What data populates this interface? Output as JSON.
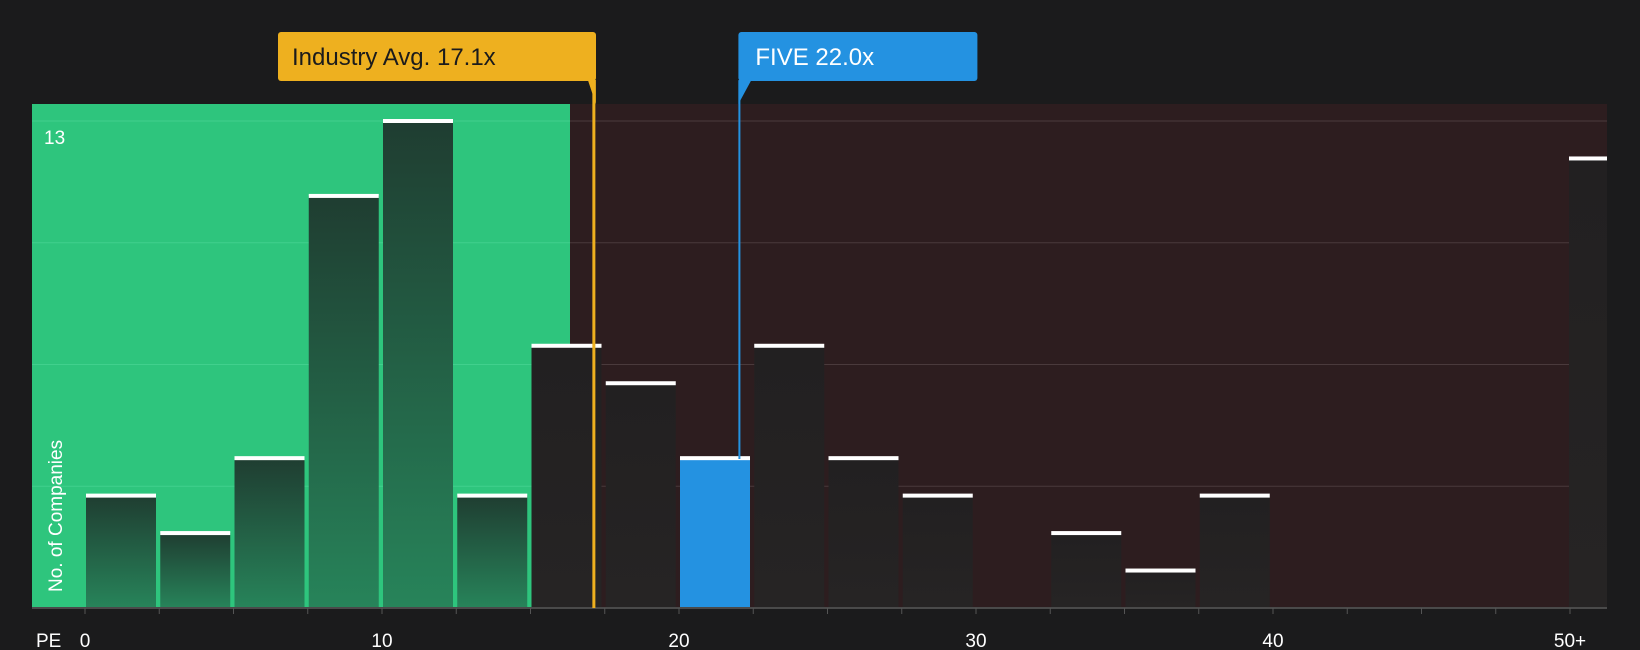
{
  "chart_data": {
    "type": "bar",
    "xlabel": "PE",
    "ylabel": "No. of Companies",
    "ymax_label": "13",
    "ylim": [
      0,
      13
    ],
    "bin_width": 2.5,
    "x_ticks": [
      "0",
      "10",
      "20",
      "30",
      "40",
      "50+"
    ],
    "bins": [
      {
        "x_start": 0,
        "count": 3
      },
      {
        "x_start": 2.5,
        "count": 2
      },
      {
        "x_start": 5,
        "count": 4
      },
      {
        "x_start": 7.5,
        "count": 11
      },
      {
        "x_start": 10,
        "count": 13
      },
      {
        "x_start": 12.5,
        "count": 3
      },
      {
        "x_start": 15,
        "count": 7
      },
      {
        "x_start": 17.5,
        "count": 6
      },
      {
        "x_start": 20,
        "count": 4,
        "highlight": true
      },
      {
        "x_start": 22.5,
        "count": 7
      },
      {
        "x_start": 25,
        "count": 4
      },
      {
        "x_start": 27.5,
        "count": 3
      },
      {
        "x_start": 32.5,
        "count": 2
      },
      {
        "x_start": 35,
        "count": 1
      },
      {
        "x_start": 37.5,
        "count": 3
      },
      {
        "x_start": 50,
        "count": 12,
        "overflow": true
      }
    ],
    "industry_avg": {
      "label": "Industry Avg. 17.1x",
      "value": 17.1
    },
    "company": {
      "label": "FIVE 22.0x",
      "value": 22.0
    },
    "colors": {
      "background": "#1b1b1c",
      "green_zone": "#2ec57d",
      "red_zone": "#2d1d1f",
      "industry_marker": "#eeb01f",
      "company_marker": "#2492e1"
    }
  }
}
